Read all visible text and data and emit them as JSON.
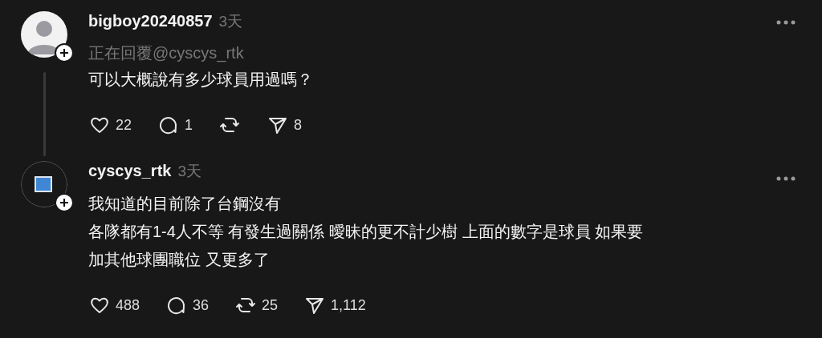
{
  "posts": [
    {
      "author": "bigboy20240857",
      "time": "3天",
      "avatar": {
        "kind": "default"
      },
      "thread_line": true,
      "reply_to": "正在回覆@cyscys_rtk",
      "lines": [
        "可以大概說有多少球員用過嗎？"
      ],
      "stats": {
        "likes": "22",
        "replies": "1",
        "shares": "8"
      }
    },
    {
      "author": "cyscys_rtk",
      "time": "3天",
      "avatar": {
        "kind": "broken"
      },
      "thread_line": false,
      "lines": [
        "我知道的目前除了台鋼沒有",
        "各隊都有1-4人不等 有發生過關係 曖昧的更不計少樹 上面的數字是球員 如果要",
        "加其他球團職位 又更多了"
      ],
      "stats": {
        "likes": "488",
        "replies": "36",
        "reposts": "25",
        "shares": "1,112"
      }
    }
  ]
}
